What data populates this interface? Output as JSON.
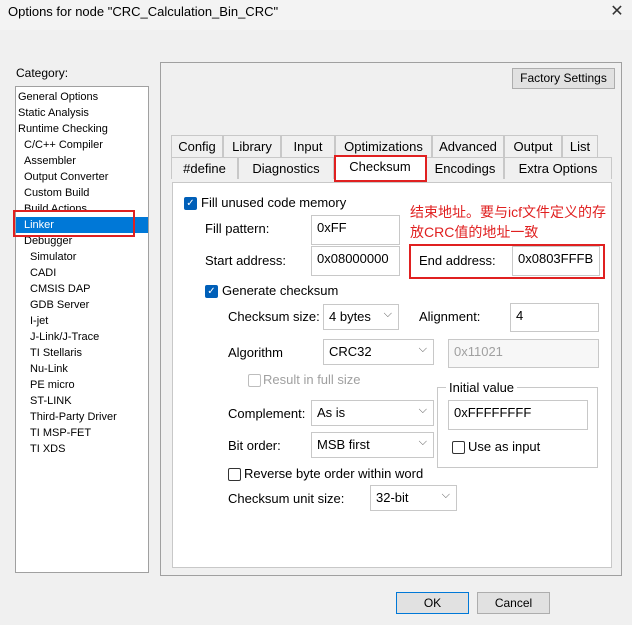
{
  "window": {
    "title": "Options for node \"CRC_Calculation_Bin_CRC\"",
    "close_glyph": "✕"
  },
  "category": {
    "label": "Category:",
    "items": [
      "General Options",
      "Static Analysis",
      "Runtime Checking",
      "C/C++ Compiler",
      "Assembler",
      "Output Converter",
      "Custom Build",
      "Build Actions",
      "Linker",
      "Debugger",
      "Simulator",
      "CADI",
      "CMSIS DAP",
      "GDB Server",
      "I-jet",
      "J-Link/J-Trace",
      "TI Stellaris",
      "Nu-Link",
      "PE micro",
      "ST-LINK",
      "Third-Party Driver",
      "TI MSP-FET",
      "TI XDS"
    ],
    "selected": "Linker"
  },
  "factory_settings": "Factory Settings",
  "tabs_row1": [
    "Config",
    "Library",
    "Input",
    "Optimizations",
    "Advanced",
    "Output",
    "List"
  ],
  "tabs_row2": [
    "#define",
    "Diagnostics",
    "Checksum",
    "Encodings",
    "Extra Options"
  ],
  "active_tab": "Checksum",
  "checksum": {
    "fill_unused": {
      "label": "Fill unused code memory",
      "checked": true
    },
    "fill_pattern": {
      "label": "Fill pattern:",
      "value": "0xFF"
    },
    "start_address": {
      "label": "Start address:",
      "value": "0x08000000"
    },
    "end_address": {
      "label": "End address:",
      "value": "0x0803FFFB"
    },
    "generate_checksum": {
      "label": "Generate checksum",
      "checked": true
    },
    "checksum_size": {
      "label": "Checksum size:",
      "value": "4 bytes"
    },
    "alignment": {
      "label": "Alignment:",
      "value": "4"
    },
    "algorithm": {
      "label": "Algorithm",
      "value": "CRC32",
      "poly": "0x11021"
    },
    "result_full_size": {
      "label": "Result in full size",
      "checked": false
    },
    "initial_value": {
      "title": "Initial value",
      "value": "0xFFFFFFFF",
      "use_as_input": "Use as input"
    },
    "complement": {
      "label": "Complement:",
      "value": "As is"
    },
    "bit_order": {
      "label": "Bit order:",
      "value": "MSB first"
    },
    "reverse_byte_order": {
      "label": "Reverse byte order within word",
      "checked": false
    },
    "unit_size": {
      "label": "Checksum unit size:",
      "value": "32-bit"
    }
  },
  "annotation": "结束地址。要与icf文件定义的存放CRC值的地址一致",
  "buttons": {
    "ok": "OK",
    "cancel": "Cancel"
  },
  "colors": {
    "selection": "#0078d7",
    "annotation_red": "#e02020",
    "checkbox_blue": "#005fb8"
  }
}
